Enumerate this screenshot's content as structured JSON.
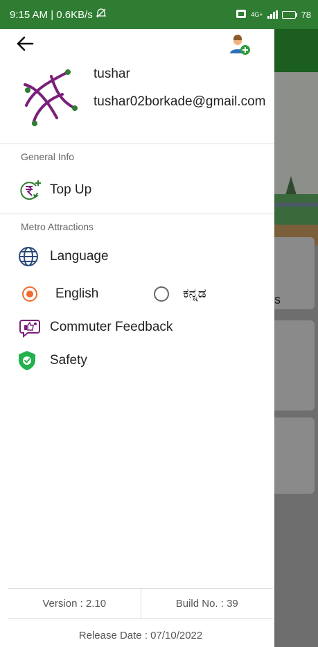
{
  "status_bar": {
    "time_speed": "9:15 AM | 0.6KB/s",
    "network": "4G+",
    "battery": "78"
  },
  "drawer": {
    "user": {
      "name": "tushar",
      "email": "tushar02borkade@gmail.com"
    },
    "sections": {
      "general": "General Info",
      "attractions": "Metro Attractions"
    },
    "items": {
      "topup": "Top Up",
      "language": "Language",
      "feedback": "Commuter Feedback",
      "safety": "Safety"
    },
    "language_options": [
      {
        "label": "English",
        "selected": true
      },
      {
        "label": "ಕನ್ನಡ",
        "selected": false
      }
    ],
    "footer": {
      "version": "Version : 2.10",
      "build": "Build No. : 39",
      "release": "Release Date : 07/10/2022"
    }
  },
  "background_app": {
    "partial_text": "s"
  },
  "colors": {
    "status_green": "#2e7d32",
    "accent_orange": "#ef6c2e",
    "safety_green": "#23b14d",
    "logo_purple": "#7a1f7a"
  }
}
